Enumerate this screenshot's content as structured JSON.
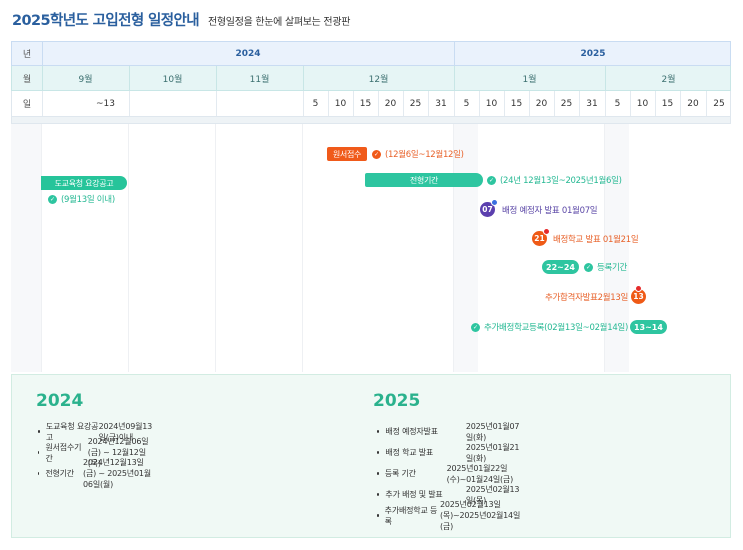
{
  "header": {
    "title": "2025학년도 고입전형 일정안내",
    "subtitle": "전형일정을 한눈에 살펴보는 전광판"
  },
  "grid": {
    "year_label": "년",
    "month_label": "월",
    "day_label": "일",
    "years": [
      "2024",
      "2025"
    ],
    "months": [
      "9월",
      "10월",
      "11월",
      "12월",
      "1월",
      "2월"
    ],
    "days": [
      "~13",
      "5",
      "10",
      "15",
      "20",
      "25",
      "31",
      "5",
      "10",
      "15",
      "20",
      "25",
      "31",
      "5",
      "10",
      "15",
      "20",
      "25"
    ]
  },
  "events": {
    "application_tag": "원서접수",
    "application_text": "(12월6일~12월12일)",
    "notice_pill": "도교육청 요강공고",
    "notice_text": "(9월13일 이내)",
    "screening_pill": "전형기간",
    "screening_text": "(24년 12월13일~2025년1월6일)",
    "assign_badge": "07",
    "assign_text": "배정 예정자 발표 01월07일",
    "school_badge": "21",
    "school_text": "배정학교 발표 01월21일",
    "register_pill": "22~24",
    "register_text": "등록기간",
    "extra_text": "추가합격자발표2월13일",
    "extra_badge": "13",
    "extra_reg_text": "추가배정학교등록(02월13일~02월14일)",
    "extra_reg_pill": "13~14"
  },
  "summary": {
    "left": {
      "year": "2024",
      "items": [
        {
          "label": "도교육청 요강공고",
          "value": "2024년09월13일(금)이내"
        },
        {
          "label": "원서접수기간",
          "value": "2024년12월06일(금) ~ 12월12일(목)"
        },
        {
          "label": "전형기간",
          "value": "2024년12월13일(금) ~ 2025년01월06일(월)"
        }
      ]
    },
    "right": {
      "year": "2025",
      "items": [
        {
          "label": "배정 예정자발표",
          "value": "2025년01월07일(화)"
        },
        {
          "label": "배정 학교 발표",
          "value": "2025년01월21일(화)"
        },
        {
          "label": "등록 기간",
          "value": "2025년01월22일(수)~01월24일(금)"
        },
        {
          "label": "추가 배정 및 발표",
          "value": "2025년02월13일(목)"
        },
        {
          "label": "추가배정학교 등록",
          "value": "2025년02월13일(목)~2025년02월14일(금)"
        }
      ]
    }
  },
  "colors": {
    "title_blue": "#2a5f9e",
    "green": "#2ec5a0",
    "orange": "#f05a1a",
    "purple": "#5b3fae"
  }
}
